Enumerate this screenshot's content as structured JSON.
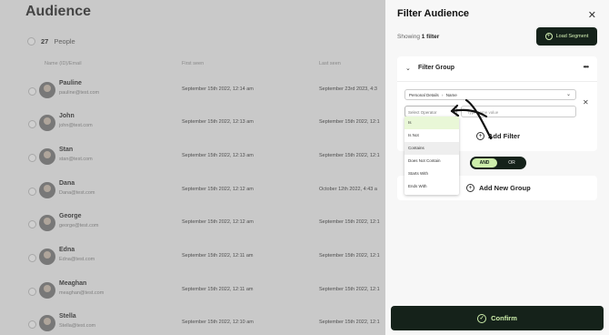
{
  "audience": {
    "title": "Audience",
    "people_count": "27",
    "people_label": "People",
    "columns": [
      "Name (ID)/Email",
      "First seen",
      "Last seen"
    ],
    "rows": [
      {
        "name": "Pauline",
        "email": "pauline@test.com",
        "first_seen": "September 15th 2022, 12:14 am",
        "last_seen": "September 23rd 2023, 4:3"
      },
      {
        "name": "John",
        "email": "john@test.com",
        "first_seen": "September 15th 2022, 12:13 am",
        "last_seen": "September 15th 2022, 12:1"
      },
      {
        "name": "Stan",
        "email": "stan@test.com",
        "first_seen": "September 15th 2022, 12:13 am",
        "last_seen": "September 15th 2022, 12:1"
      },
      {
        "name": "Dana",
        "email": "Dana@test.com",
        "first_seen": "September 15th 2022, 12:12 am",
        "last_seen": "October 12th 2022, 4:43 a"
      },
      {
        "name": "George",
        "email": "george@test.com",
        "first_seen": "September 15th 2022, 12:12 am",
        "last_seen": "September 15th 2022, 12:1"
      },
      {
        "name": "Edna",
        "email": "Edna@test.com",
        "first_seen": "September 15th 2022, 12:11 am",
        "last_seen": "September 15th 2022, 12:1"
      },
      {
        "name": "Meaghan",
        "email": "meaghan@test.com",
        "first_seen": "September 15th 2022, 12:11 am",
        "last_seen": "September 15th 2022, 12:1"
      },
      {
        "name": "Stella",
        "email": "Stella@test.com",
        "first_seen": "September 15th 2022, 12:10 am",
        "last_seen": "September 15th 2022, 12:1"
      }
    ]
  },
  "panel": {
    "title": "Filter Audience",
    "showing_prefix": "Showing",
    "showing_count": "1 filter",
    "load_segment": "Load Segment",
    "group_title": "Filter Group",
    "field_category": "Personal Details",
    "field_name": "Name",
    "operator_placeholder": "Select Operator",
    "value_placeholder": "Type name value",
    "add_filter": "Add Filter",
    "and_label": "AND",
    "or_label": "OR",
    "add_group": "Add New Group",
    "confirm": "Confirm"
  },
  "operators": [
    "Is",
    "Is Not",
    "Contains",
    "Does Not Contain",
    "Starts With",
    "Ends With"
  ],
  "colors": {
    "accent_dark": "#15221a",
    "accent_light": "#cdeeab"
  }
}
